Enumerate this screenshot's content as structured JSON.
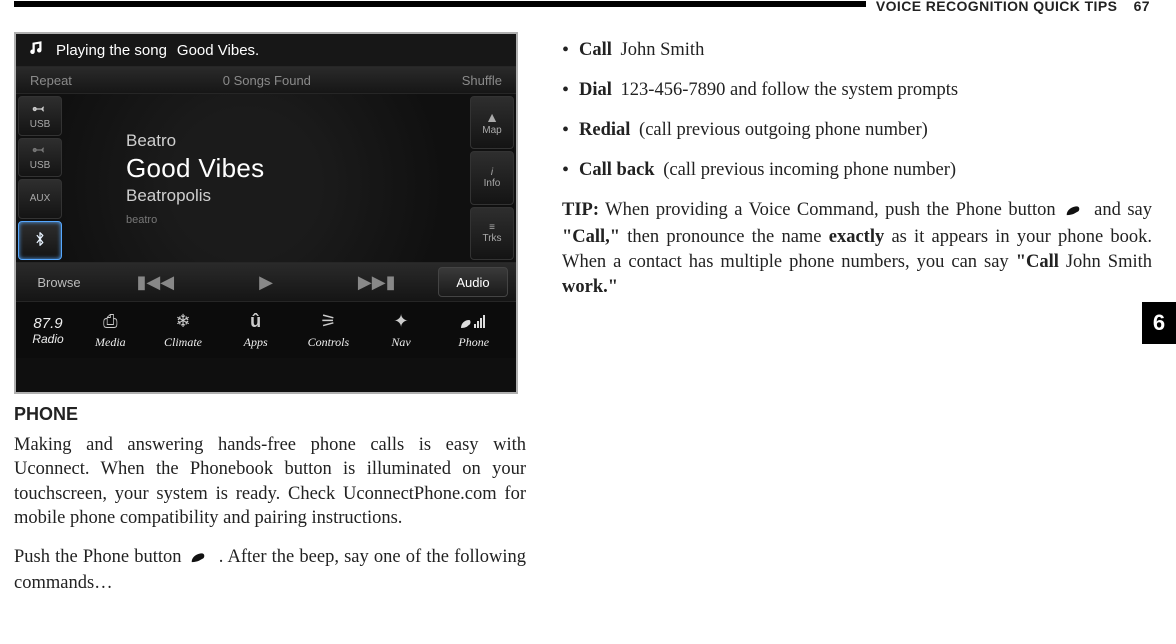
{
  "header": {
    "title": "VOICE RECOGNITION QUICK TIPS",
    "page": "67",
    "tab": "6"
  },
  "screenshot": {
    "nowplaying_prefix": "Playing the song",
    "nowplaying_title": "Good Vibes.",
    "repeat": "Repeat",
    "songs_found": "0 Songs Found",
    "shuffle": "Shuffle",
    "sources": [
      "USB",
      "USB",
      "AUX",
      "BT"
    ],
    "track": {
      "artist": "Beatro",
      "title": "Good Vibes",
      "album": "Beatropolis",
      "brand": "beatro"
    },
    "right_buttons": [
      "Map",
      "Info",
      "Trks"
    ],
    "browse": "Browse",
    "audio": "Audio",
    "frequency": "87.9",
    "bottom_items": [
      "Radio",
      "Media",
      "Climate",
      "Apps",
      "Controls",
      "Nav",
      "Phone"
    ]
  },
  "left": {
    "section_title": "PHONE",
    "para1": "Making and answering hands-free phone calls is easy with Uconnect. When the Phonebook button is illuminated on your touchscreen, your system is ready. Check UconnectPhone.com for mobile phone compatibility and pairing instructions.",
    "prompt_a": "Push the Phone button",
    "prompt_b": ". After the beep, say one of the following commands…"
  },
  "right": {
    "bullets": [
      {
        "cmd": "Call",
        "rest": "John Smith"
      },
      {
        "cmd": "Dial",
        "rest": "123-456-7890 and follow the system prompts"
      },
      {
        "cmd": "Redial",
        "rest": "(call previous outgoing phone number)"
      },
      {
        "cmd": "Call back",
        "rest": "(call previous incoming phone number)"
      }
    ],
    "tip": {
      "label": "TIP:",
      "t1": "When providing a Voice Command, push the Phone button",
      "t2": "and say",
      "call_word": "\"Call,\"",
      "t3": "then pronounce the name",
      "exactly": "exactly",
      "t4": "as it appears in your phone book. When a contact has multiple phone numbers, you can say",
      "call2": "\"Call",
      "name": "John Smith",
      "work": "work.\""
    }
  }
}
